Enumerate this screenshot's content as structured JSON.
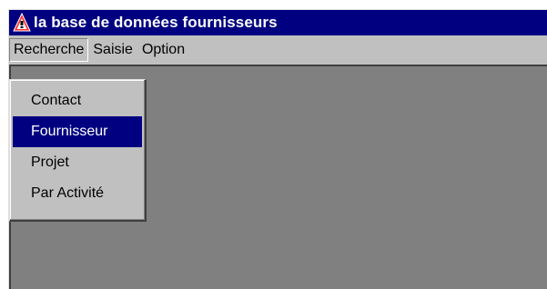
{
  "window": {
    "title": "la base de données fournisseurs",
    "icon": "app-warning-triangle-icon"
  },
  "menubar": {
    "items": [
      {
        "label": "Recherche",
        "state": "open"
      },
      {
        "label": "Saisie"
      },
      {
        "label": "Option"
      }
    ]
  },
  "dropdown": {
    "items": [
      {
        "label": "Contact"
      },
      {
        "label": "Fournisseur",
        "selected": true
      },
      {
        "label": "Projet"
      },
      {
        "label": "Par Activité"
      }
    ]
  },
  "colors": {
    "titlebar": "#000080",
    "client_area": "#808080",
    "menu_bg": "#c0c0c0",
    "selection": "#000080"
  }
}
